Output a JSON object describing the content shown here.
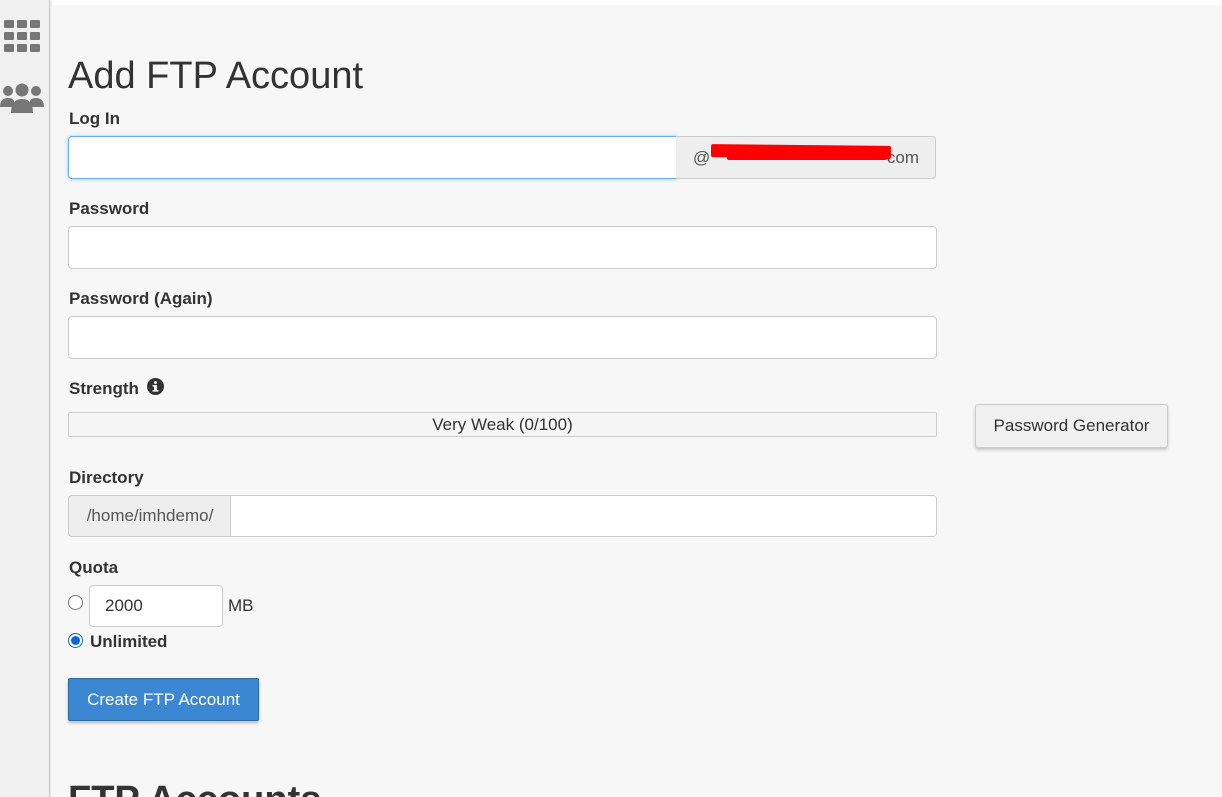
{
  "page": {
    "title": "Add FTP Account"
  },
  "login": {
    "label": "Log In",
    "value": "",
    "domain_prefix": "@",
    "domain_suffix": "com"
  },
  "password": {
    "label": "Password",
    "value": ""
  },
  "password_again": {
    "label": "Password (Again)",
    "value": ""
  },
  "strength": {
    "label": "Strength",
    "info_icon": "info-circle-icon",
    "text": "Very Weak (0/100)",
    "score": 0
  },
  "password_generator": {
    "label": "Password Generator"
  },
  "directory": {
    "label": "Directory",
    "prefix": "/home/imhdemo/",
    "value": ""
  },
  "quota": {
    "label": "Quota",
    "value": "2000",
    "unit": "MB",
    "unlimited_label": "Unlimited",
    "selected": "unlimited"
  },
  "create_button": {
    "label": "Create FTP Account"
  },
  "ftp_accounts": {
    "title": "FTP Accounts"
  },
  "colors": {
    "primary_button": "#3b87d1",
    "focus_border": "#66afe9",
    "radio_checked": "#0a66d8",
    "redaction": "#ff0000"
  },
  "sidebar": {
    "icons": [
      "apps-grid-icon",
      "users-icon"
    ]
  }
}
